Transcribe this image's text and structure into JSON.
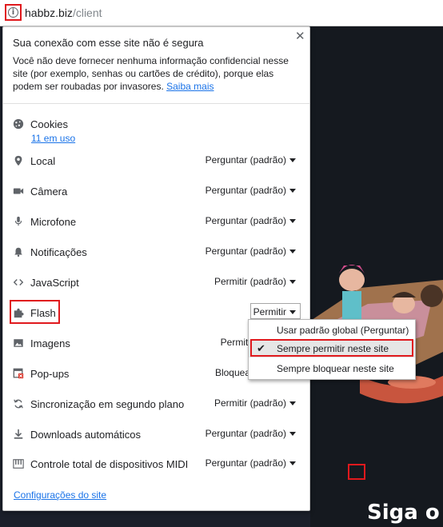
{
  "address_bar": {
    "host": "habbz.biz",
    "path": "/client"
  },
  "security": {
    "title": "Sua conexão com esse site não é segura",
    "body": "Você não deve fornecer nenhuma informação confidencial nesse site (por exemplo, senhas ou cartões de crédito), porque elas podem ser roubadas por invasores.",
    "learn_more": "Saiba mais"
  },
  "cookies": {
    "label": "Cookies",
    "in_use": "11 em uso"
  },
  "permissions": [
    {
      "label": "Local",
      "value": "Perguntar (padrão)",
      "icon": "location-pin-icon"
    },
    {
      "label": "Câmera",
      "value": "Perguntar (padrão)",
      "icon": "camera-icon"
    },
    {
      "label": "Microfone",
      "value": "Perguntar (padrão)",
      "icon": "microphone-icon"
    },
    {
      "label": "Notificações",
      "value": "Perguntar (padrão)",
      "icon": "bell-icon"
    },
    {
      "label": "JavaScript",
      "value": "Permitir (padrão)",
      "icon": "code-icon"
    },
    {
      "label": "Flash",
      "value": "Permitir",
      "icon": "puzzle-icon"
    },
    {
      "label": "Imagens",
      "value": "Permitir",
      "icon": "image-icon"
    },
    {
      "label": "Pop-ups",
      "value": "Bloquear",
      "icon": "popup-blocked-icon"
    },
    {
      "label": "Sincronização em segundo plano",
      "value": "Permitir (padrão)",
      "icon": "sync-icon"
    },
    {
      "label": "Downloads automáticos",
      "value": "Perguntar (padrão)",
      "icon": "download-icon"
    },
    {
      "label": "Controle total de dispositivos MIDI",
      "value": "Perguntar (padrão)",
      "icon": "piano-icon"
    }
  ],
  "flash_dropdown": {
    "options": [
      "Usar padrão global (Perguntar)",
      "Sempre permitir neste site",
      "Sempre bloquear neste site"
    ],
    "selected": "Sempre permitir neste site"
  },
  "site_settings_link": "Configurações do site",
  "page_cta": "Siga o p",
  "colors": {
    "highlight": "#e0191d",
    "link": "#1a73e8",
    "page_background": "#1b1f2a"
  }
}
